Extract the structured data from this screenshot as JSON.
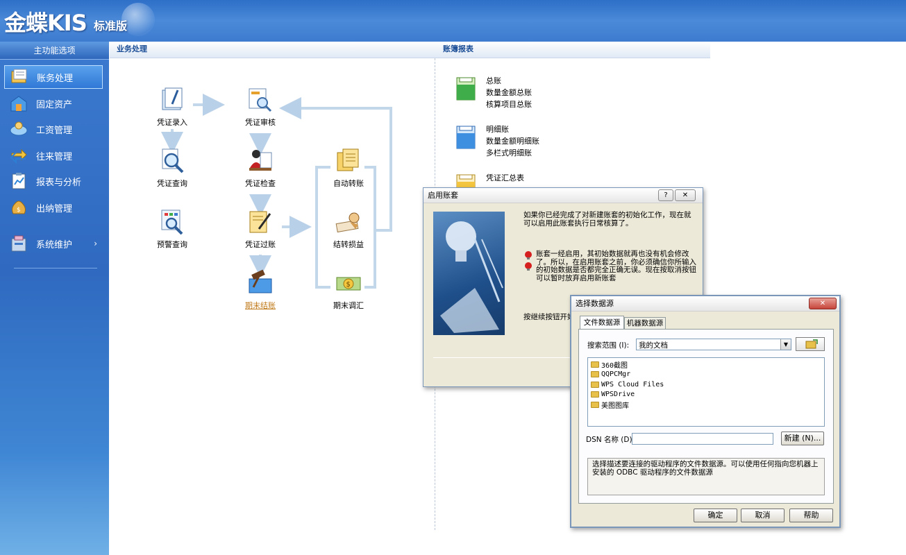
{
  "app": {
    "brand": "金蝶KIS",
    "edition": "标准版"
  },
  "sidebar": {
    "title": "主功能选项",
    "items": [
      {
        "label": "账务处理"
      },
      {
        "label": "固定资产"
      },
      {
        "label": "工资管理"
      },
      {
        "label": "往来管理"
      },
      {
        "label": "报表与分析"
      },
      {
        "label": "出纳管理"
      },
      {
        "label": "系统维护"
      }
    ],
    "submenu_arrow": "›"
  },
  "business": {
    "title": "业务处理",
    "items": [
      {
        "label": "凭证录入"
      },
      {
        "label": "凭证审核"
      },
      {
        "label": "凭证查询"
      },
      {
        "label": "凭证检查"
      },
      {
        "label": "自动转账"
      },
      {
        "label": "预警查询"
      },
      {
        "label": "凭证过账"
      },
      {
        "label": "结转损益"
      },
      {
        "label": "期末结账"
      },
      {
        "label": "期末调汇"
      }
    ]
  },
  "ledger": {
    "title": "账簿报表",
    "groups": [
      {
        "lines": [
          "总账",
          "数量金额总账",
          "核算项目总账"
        ]
      },
      {
        "lines": [
          "明细账",
          "数量金额明细账",
          "多栏式明细账"
        ]
      },
      {
        "lines": [
          "凭证汇总表",
          "",
          ""
        ]
      }
    ]
  },
  "enable_dialog": {
    "title": "启用账套",
    "help_btn": "?",
    "close_btn": "✕",
    "intro": "如果你已经完成了对新建账套的初始化工作，现在就可以启用此账套执行日常核算了。",
    "warning": "账套一经启用，其初始数据就再也没有机会修改了。所以，在启用账套之前，你必须确信你所输入的初始数据是否都完全正确无误。现在按取消按钮可以暂时放弃启用新账套",
    "footer": "按继续按钮开始"
  },
  "datasource_dialog": {
    "title": "选择数据源",
    "close_btn": "✕",
    "tabs": [
      {
        "label": "文件数据源"
      },
      {
        "label": "机器数据源"
      }
    ],
    "search_label": "搜索范围 (I):",
    "search_value": "我的文档",
    "folders": [
      "360截图",
      "QQPCMgr",
      "WPS Cloud Files",
      "WPSDrive",
      "美图图库"
    ],
    "dsn_label": "DSN 名称 (D):",
    "dsn_value": "",
    "new_button": "新建 (N)...",
    "description": "选择描述要连接的驱动程序的文件数据源。可以使用任何指向您机器上安装的 ODBC 驱动程序的文件数据源",
    "buttons": {
      "ok": "确定",
      "cancel": "取消",
      "help": "帮助"
    }
  }
}
